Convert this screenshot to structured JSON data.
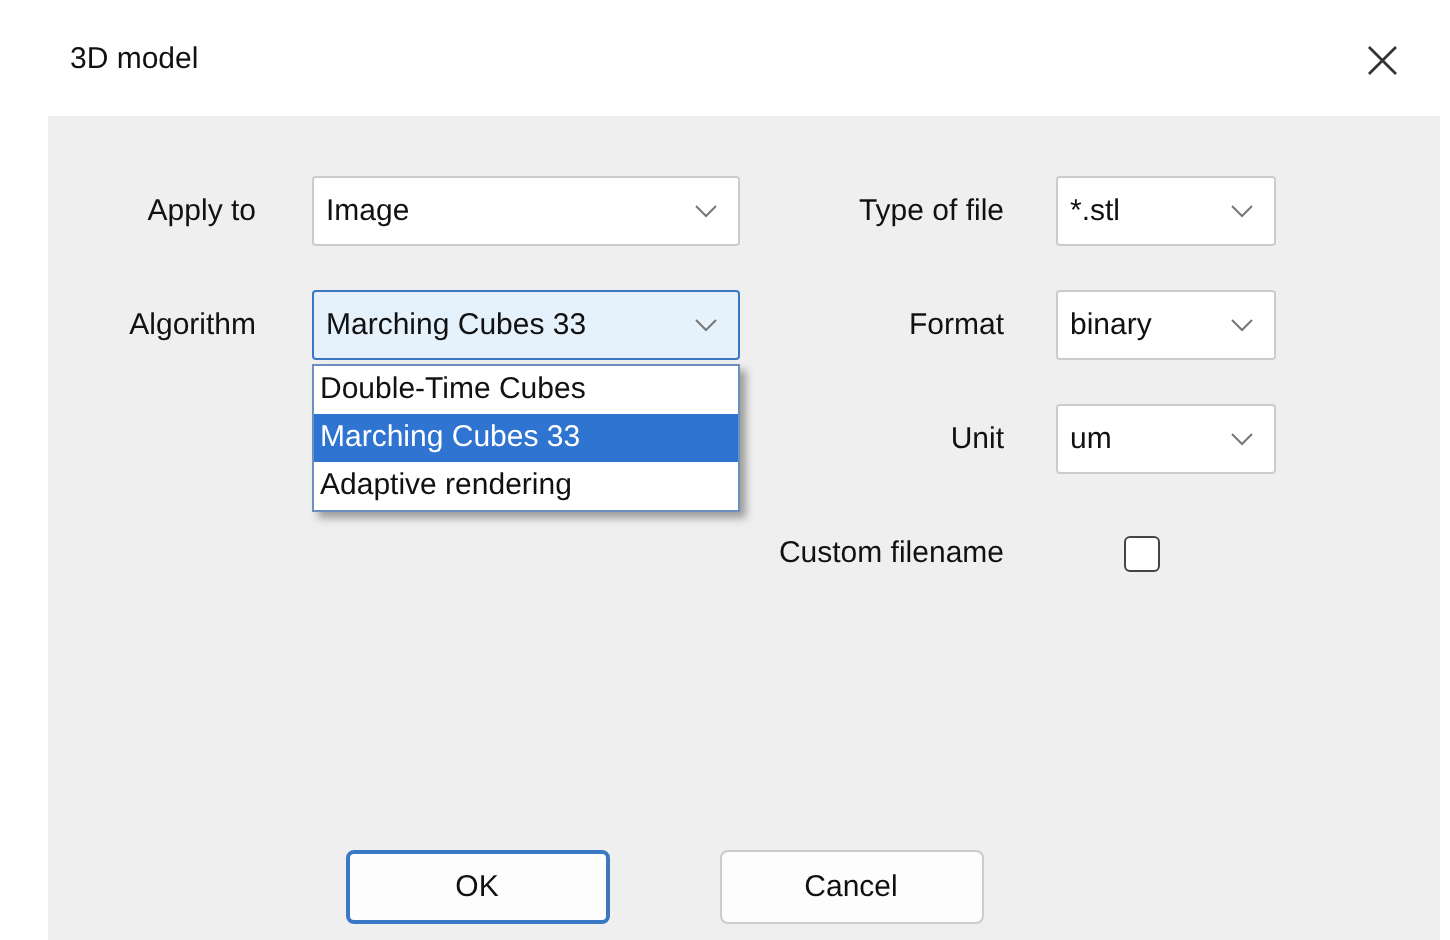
{
  "window": {
    "title": "3D model",
    "close": "×"
  },
  "left_fields": [
    {
      "kind": "combo",
      "label": "Apply to",
      "value": "Image",
      "open": false
    },
    {
      "kind": "combo",
      "label": "Algorithm",
      "value": "Marching Cubes 33",
      "open": true,
      "options": [
        {
          "label": "Double-Time Cubes",
          "selected": false
        },
        {
          "label": "Marching Cubes 33",
          "selected": true
        },
        {
          "label": "Adaptive rendering",
          "selected": false
        }
      ]
    }
  ],
  "right_fields": [
    {
      "kind": "combo",
      "label": "Type of file",
      "value": "*.stl",
      "open": false
    },
    {
      "kind": "combo",
      "label": "Format",
      "value": "binary",
      "open": false
    },
    {
      "kind": "combo",
      "label": "Unit",
      "value": "um",
      "open": false
    },
    {
      "kind": "checkbox",
      "label": "Custom filename",
      "checked": false
    }
  ],
  "buttons": [
    {
      "label": "OK",
      "default": true
    },
    {
      "label": "Cancel",
      "default": false
    }
  ]
}
